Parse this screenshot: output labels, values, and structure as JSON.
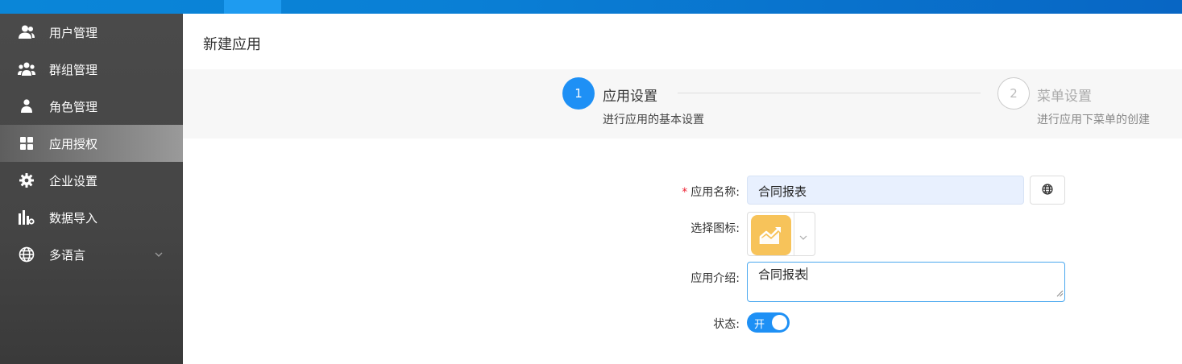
{
  "sidebar": {
    "items": [
      {
        "label": "用户管理",
        "icon": "users-icon"
      },
      {
        "label": "群组管理",
        "icon": "group-icon"
      },
      {
        "label": "角色管理",
        "icon": "user-icon"
      },
      {
        "label": "应用授权",
        "icon": "apps-grid-icon",
        "active": true
      },
      {
        "label": "企业设置",
        "icon": "gear-icon"
      },
      {
        "label": "数据导入",
        "icon": "data-import-icon"
      },
      {
        "label": "多语言",
        "icon": "globe-icon",
        "expandable": true
      }
    ]
  },
  "page": {
    "title": "新建应用"
  },
  "steps": [
    {
      "number": "1",
      "title": "应用设置",
      "desc": "进行应用的基本设置",
      "status": "active"
    },
    {
      "number": "2",
      "title": "菜单设置",
      "desc": "进行应用下菜单的创建",
      "status": "pending"
    }
  ],
  "form": {
    "name_label": "应用名称:",
    "name_required": "*",
    "name_value": "合同报表",
    "icon_label": "选择图标:",
    "intro_label": "应用介绍:",
    "intro_value": "合同报表",
    "status_label": "状态:",
    "status_on_text": "开"
  },
  "colors": {
    "primary": "#1e90f5",
    "icon_tile": "#f7c35a",
    "sidebar": "#4a4a4a"
  }
}
